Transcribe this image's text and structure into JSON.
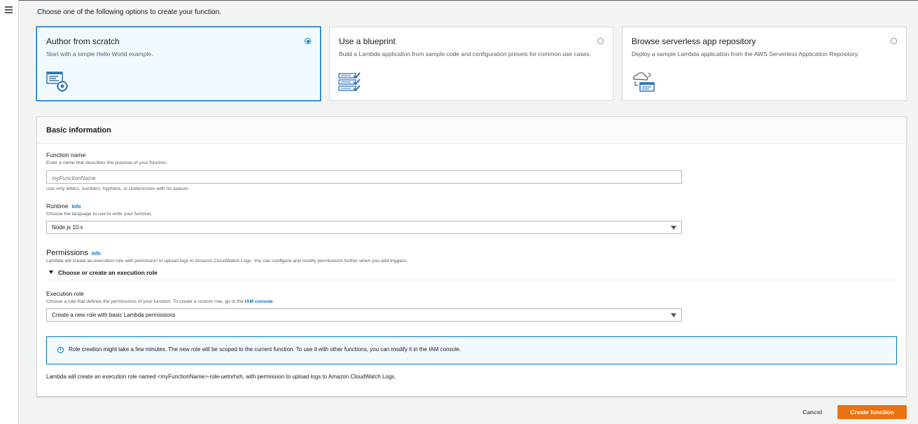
{
  "page": {
    "intro": "Choose one of the following options to create your function."
  },
  "options": [
    {
      "title": "Author from scratch",
      "description": "Start with a simple Hello World example.",
      "selected": true,
      "icon": "code-gear-icon"
    },
    {
      "title": "Use a blueprint",
      "description": "Build a Lambda application from sample code and configuration presets for common use cases.",
      "selected": false,
      "icon": "blueprint-checklist-icon"
    },
    {
      "title": "Browse serverless app repository",
      "description": "Deploy a sample Lambda application from the AWS Serverless Application Repository.",
      "selected": false,
      "icon": "cloud-repository-icon"
    }
  ],
  "basic_info": {
    "heading": "Basic information",
    "function_name": {
      "label": "Function name",
      "description": "Enter a name that describes the purpose of your function.",
      "placeholder": "myFunctionName",
      "value": "",
      "constraint": "Use only letters, numbers, hyphens, or underscores with no spaces."
    },
    "runtime": {
      "label": "Runtime",
      "info": "Info",
      "description": "Choose the language to use to write your function.",
      "value": "Node.js 10.x"
    },
    "permissions": {
      "title": "Permissions",
      "info": "Info",
      "description": "Lambda will create an execution role with permission to upload logs to Amazon CloudWatch Logs. You can configure and modify permissions further when you add triggers.",
      "expander": "Choose or create an execution role"
    },
    "execution_role": {
      "label": "Execution role",
      "description": "Choose a role that defines the permissions of your function. To create a custom role, go to the",
      "link": "IAM console",
      "value": "Create a new role with basic Lambda permissions"
    },
    "alert": "Role creation might take a few minutes. The new role will be scoped to the current function. To use it with other functions, you can modify it in the IAM console.",
    "note": "Lambda will create an execution role named <myFunctionName>-role-uetnrhxh, with permission to upload logs to Amazon CloudWatch Logs."
  },
  "actions": {
    "cancel": "Cancel",
    "create": "Create function"
  },
  "colors": {
    "accent": "#0073bb",
    "primary_button": "#ec7211",
    "background": "#f2f3f3"
  }
}
